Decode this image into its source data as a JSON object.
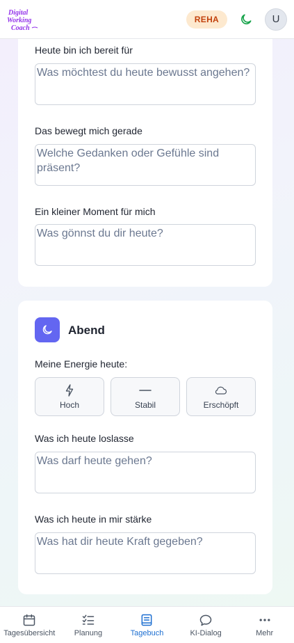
{
  "header": {
    "logo_text": "Digital Working Coach",
    "badge": "REHA",
    "avatar_initial": "U"
  },
  "morning": {
    "fields": [
      {
        "label": "Heute bin ich bereit für",
        "placeholder": "Was möchtest du heute bewusst angehen?"
      },
      {
        "label": "Das bewegt mich gerade",
        "placeholder": "Welche Gedanken oder Gefühle sind präsent?"
      },
      {
        "label": "Ein kleiner Moment für mich",
        "placeholder": "Was gönnst du dir heute?"
      }
    ]
  },
  "evening": {
    "title": "Abend",
    "energy_label": "Meine Energie heute:",
    "energy_options": [
      "Hoch",
      "Stabil",
      "Erschöpft"
    ],
    "fields": [
      {
        "label": "Was ich heute loslasse",
        "placeholder": "Was darf heute gehen?"
      },
      {
        "label": "Was ich heute in mir stärke",
        "placeholder": "Was hat dir heute Kraft gegeben?"
      }
    ]
  },
  "nav": {
    "items": [
      "Tagesübersicht",
      "Planung",
      "Tagebuch",
      "KI-Dialog",
      "Mehr"
    ],
    "active": "Tagebuch"
  },
  "colors": {
    "accent": "#1d6fd1",
    "section_icon_bg": "#6366f1",
    "badge_bg": "#fde9cf",
    "badge_text": "#c2410c",
    "moon_icon": "#16a34a",
    "logo": "#9333ea"
  }
}
